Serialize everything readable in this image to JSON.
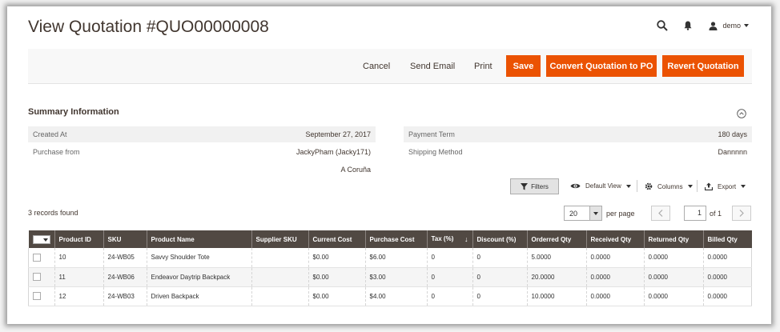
{
  "header": {
    "title": "View Quotation #QUO00000008",
    "user": "demo",
    "icons": [
      "search-icon",
      "bell-icon",
      "user-icon"
    ]
  },
  "actions": {
    "cancel": "Cancel",
    "send_email": "Send Email",
    "print": "Print",
    "save": "Save",
    "convert": "Convert Quotation to PO",
    "revert": "Revert Quotation",
    "accent_color": "#eb5202"
  },
  "summary": {
    "title": "Summary Information",
    "left": [
      {
        "label": "Created At",
        "value": "September 27, 2017"
      },
      {
        "label": "Purchase from",
        "value": "JackyPham (Jacky171)"
      },
      {
        "label": "",
        "value": "A Coruña"
      }
    ],
    "right": [
      {
        "label": "Payment Term",
        "value": "180 days"
      },
      {
        "label": "Shipping Method",
        "value": "Dannnnn"
      }
    ]
  },
  "toolbar": {
    "filters": "Filters",
    "view": "Default View",
    "columns": "Columns",
    "export": "Export"
  },
  "pager": {
    "records": "3 records found",
    "per_page_value": "20",
    "per_page_label": "per page",
    "current_page": "1",
    "of_label": "of 1"
  },
  "grid": {
    "header_bg": "#514943",
    "columns": [
      "Product ID",
      "SKU",
      "Product Name",
      "Supplier SKU",
      "Current Cost",
      "Purchase Cost",
      "Tax (%)",
      "Discount (%)",
      "Orderred Qty",
      "Received Qty",
      "Returned Qty",
      "Billed Qty"
    ],
    "rows": [
      [
        "10",
        "24-WB05",
        "Savvy Shoulder Tote",
        "",
        "$0.00",
        "$6.00",
        "0",
        "0",
        "5.0000",
        "0.0000",
        "0.0000",
        "0.0000"
      ],
      [
        "11",
        "24-WB06",
        "Endeavor Daytrip Backpack",
        "",
        "$0.00",
        "$3.00",
        "0",
        "0",
        "20.0000",
        "0.0000",
        "0.0000",
        "0.0000"
      ],
      [
        "12",
        "24-WB03",
        "Driven Backpack",
        "",
        "$0.00",
        "$4.00",
        "0",
        "0",
        "10.0000",
        "0.0000",
        "0.0000",
        "0.0000"
      ]
    ]
  }
}
